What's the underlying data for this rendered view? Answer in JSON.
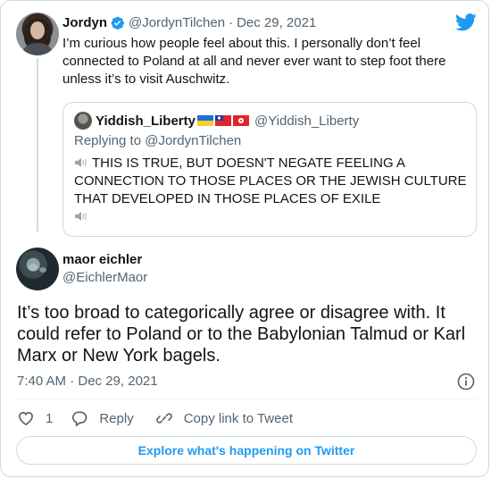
{
  "parent_tweet": {
    "display_name": "Jordyn",
    "handle": "@JordynTilchen",
    "separator": "·",
    "date": "Dec 29, 2021",
    "text": "I’m curious how people feel about this. I personally don’t feel connected to Poland at all and never ever want to step foot there unless it’s to visit Auschwitz.",
    "verified": true
  },
  "quoted_tweet": {
    "display_name": "Yiddish_Liberty",
    "flags": [
      "ukraine-flag",
      "taiwan-flag",
      "hong-kong-flag"
    ],
    "handle": "@Yiddish_Liberty",
    "replying_to": "Replying to @JordynTilchen",
    "text": "THIS IS TRUE, BUT DOESN'T NEGATE FEELING A CONNECTION TO THOSE PLACES OR THE JEWISH CULTURE THAT DEVELOPED IN THOSE PLACES OF EXILE"
  },
  "main_tweet": {
    "display_name": "maor eichler",
    "handle": "@EichlerMaor",
    "text": "It’s too broad to categorically agree or disagree with. It could refer to Poland or to the Babylonian Talmud or Karl Marx or New York bagels.",
    "timestamp": "7:40 AM · Dec 29, 2021"
  },
  "actions": {
    "like_count": "1",
    "reply_label": "Reply",
    "copy_link_label": "Copy link to Tweet"
  },
  "explore_label": "Explore what's happening on Twitter",
  "colors": {
    "twitter_blue": "#1d9bf0",
    "secondary_text": "#536471",
    "border": "#cfd9de"
  }
}
